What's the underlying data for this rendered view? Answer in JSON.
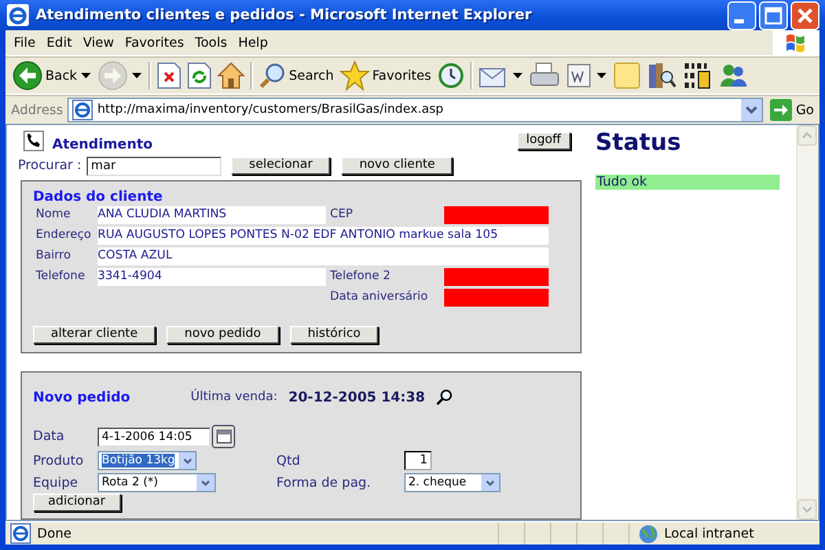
{
  "window": {
    "title": "Atendimento clientes e pedidos - Microsoft Internet Explorer"
  },
  "menu": [
    {
      "label": "File"
    },
    {
      "label": "Edit"
    },
    {
      "label": "View"
    },
    {
      "label": "Favorites"
    },
    {
      "label": "Tools"
    },
    {
      "label": "Help"
    }
  ],
  "toolbar": [
    {
      "kind": "back",
      "label": "Back",
      "dropdown": true
    },
    {
      "kind": "forward",
      "dropdown": true,
      "disabled": true
    },
    {
      "kind": "separator"
    },
    {
      "kind": "stop"
    },
    {
      "kind": "refresh"
    },
    {
      "kind": "home"
    },
    {
      "kind": "separator"
    },
    {
      "kind": "search",
      "label": "Search"
    },
    {
      "kind": "favorites",
      "label": "Favorites"
    },
    {
      "kind": "history"
    },
    {
      "kind": "separator"
    },
    {
      "kind": "mail",
      "dropdown": true
    },
    {
      "kind": "print"
    },
    {
      "kind": "edit",
      "dropdown": true
    },
    {
      "kind": "note"
    },
    {
      "kind": "research"
    },
    {
      "kind": "binary"
    },
    {
      "kind": "messenger"
    }
  ],
  "address": {
    "label": "Address",
    "url": "http://maxima/inventory/customers/BrasilGas/index.asp",
    "go": "Go"
  },
  "page": {
    "header": {
      "title": "Atendimento",
      "logoff": "logoff"
    },
    "search": {
      "label": "Procurar :",
      "value": "mar",
      "buttons": [
        "selecionar",
        "novo cliente"
      ]
    },
    "client": {
      "title": "Dados do cliente",
      "fields": [
        {
          "kind": "left",
          "label": "Nome",
          "value": "ANA CLUDIA MARTINS"
        },
        {
          "kind": "right",
          "label": "CEP",
          "invalid": true
        },
        {
          "kind": "wide",
          "label": "Endereço",
          "value": "RUA AUGUSTO LOPES PONTES N-02 EDF ANTONIO markue sala 105"
        },
        {
          "kind": "wide",
          "label": "Bairro",
          "value": "COSTA AZUL"
        },
        {
          "kind": "left",
          "label": "Telefone",
          "value": "3341-4904"
        },
        {
          "kind": "right",
          "label": "Telefone 2",
          "invalid": true
        },
        {
          "kind": "right",
          "label": "Data aniversário",
          "invalid": true
        }
      ],
      "buttons": [
        "alterar cliente",
        "novo pedido",
        "histórico"
      ]
    },
    "order": {
      "title": "Novo pedido",
      "last_sale_label": "Última venda:",
      "last_sale": "20-12-2005 14:38",
      "rows": [
        [
          {
            "kind": "date",
            "label": "Data",
            "value": "4-1-2006 14:05",
            "highlighted": false
          }
        ],
        [
          {
            "kind": "select",
            "label": "Produto",
            "value": "Botijão 13kg",
            "highlighted": true
          },
          {
            "kind": "number",
            "label": "Qtd",
            "value": "1",
            "highlighted": false
          }
        ],
        [
          {
            "kind": "select",
            "label": "Equipe",
            "value": "Rota 2 (*)",
            "highlighted": false
          },
          {
            "kind": "select",
            "label": "Forma de pag.",
            "value": "2. cheque",
            "highlighted": false
          }
        ]
      ],
      "button": "adicionar"
    },
    "status": {
      "title": "Status",
      "message": "Tudo ok"
    }
  },
  "status_bar": {
    "text": "Done",
    "zone": "Local intranet"
  }
}
